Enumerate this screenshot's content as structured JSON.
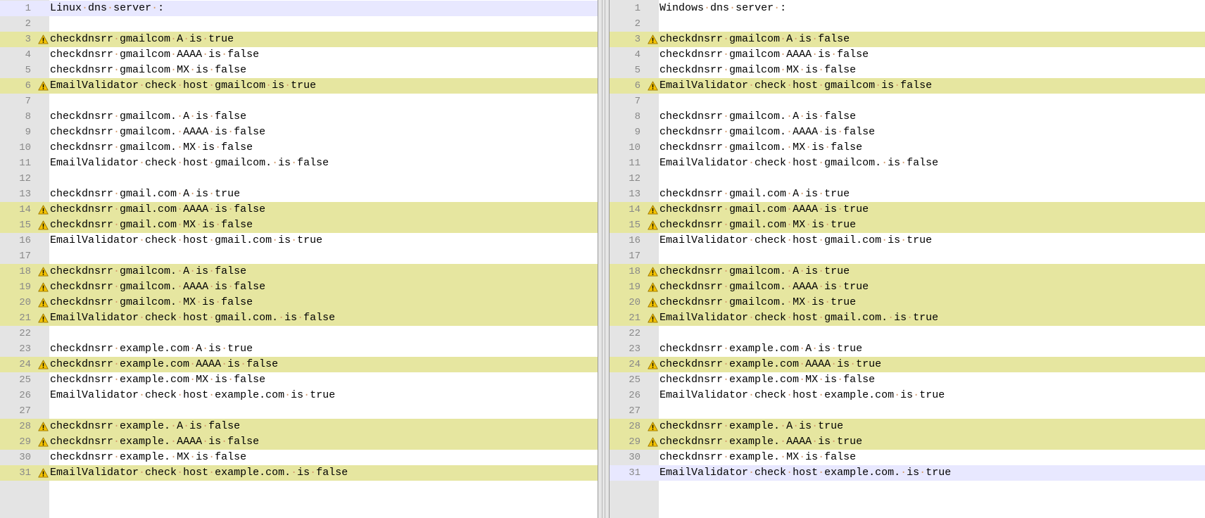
{
  "colors": {
    "diff_line": "#e6e6a0",
    "current_line": "#e8e8ff",
    "gutter": "#e4e4e4",
    "line_number": "#888888",
    "whitespace_dot": "#d49a6a"
  },
  "icons": {
    "diff_marker": "warning-triangle-icon"
  },
  "left_pane": {
    "lines": [
      {
        "num": "1",
        "text": "Linux dns server :",
        "state": "current"
      },
      {
        "num": "2",
        "text": "",
        "state": "same"
      },
      {
        "num": "3",
        "text": "checkdnsrr gmailcom A is true",
        "state": "diff"
      },
      {
        "num": "4",
        "text": "checkdnsrr gmailcom AAAA is false",
        "state": "same"
      },
      {
        "num": "5",
        "text": "checkdnsrr gmailcom MX is false",
        "state": "same"
      },
      {
        "num": "6",
        "text": "EmailValidator check host gmailcom is true",
        "state": "diff"
      },
      {
        "num": "7",
        "text": "",
        "state": "same"
      },
      {
        "num": "8",
        "text": "checkdnsrr gmailcom. A is false",
        "state": "same"
      },
      {
        "num": "9",
        "text": "checkdnsrr gmailcom. AAAA is false",
        "state": "same"
      },
      {
        "num": "10",
        "text": "checkdnsrr gmailcom. MX is false",
        "state": "same"
      },
      {
        "num": "11",
        "text": "EmailValidator check host gmailcom. is false",
        "state": "same"
      },
      {
        "num": "12",
        "text": "",
        "state": "same"
      },
      {
        "num": "13",
        "text": "checkdnsrr gmail.com A is true",
        "state": "same"
      },
      {
        "num": "14",
        "text": "checkdnsrr gmail.com AAAA is false",
        "state": "diff"
      },
      {
        "num": "15",
        "text": "checkdnsrr gmail.com MX is false",
        "state": "diff"
      },
      {
        "num": "16",
        "text": "EmailValidator check host gmail.com is true",
        "state": "same"
      },
      {
        "num": "17",
        "text": "",
        "state": "same"
      },
      {
        "num": "18",
        "text": "checkdnsrr gmailcom. A is false",
        "state": "diff"
      },
      {
        "num": "19",
        "text": "checkdnsrr gmailcom. AAAA is false",
        "state": "diff"
      },
      {
        "num": "20",
        "text": "checkdnsrr gmailcom. MX is false",
        "state": "diff"
      },
      {
        "num": "21",
        "text": "EmailValidator check host gmail.com. is false",
        "state": "diff"
      },
      {
        "num": "22",
        "text": "",
        "state": "same"
      },
      {
        "num": "23",
        "text": "checkdnsrr example.com A is true",
        "state": "same"
      },
      {
        "num": "24",
        "text": "checkdnsrr example.com AAAA is false",
        "state": "diff"
      },
      {
        "num": "25",
        "text": "checkdnsrr example.com MX is false",
        "state": "same"
      },
      {
        "num": "26",
        "text": "EmailValidator check host example.com is true",
        "state": "same"
      },
      {
        "num": "27",
        "text": "",
        "state": "same"
      },
      {
        "num": "28",
        "text": "checkdnsrr example. A is false",
        "state": "diff"
      },
      {
        "num": "29",
        "text": "checkdnsrr example. AAAA is false",
        "state": "diff"
      },
      {
        "num": "30",
        "text": "checkdnsrr example. MX is false",
        "state": "same"
      },
      {
        "num": "31",
        "text": "EmailValidator check host example.com. is false",
        "state": "diff"
      }
    ]
  },
  "right_pane": {
    "lines": [
      {
        "num": "1",
        "text": "Windows dns server :",
        "state": "same"
      },
      {
        "num": "2",
        "text": "",
        "state": "same"
      },
      {
        "num": "3",
        "text": "checkdnsrr gmailcom A is false",
        "state": "diff"
      },
      {
        "num": "4",
        "text": "checkdnsrr gmailcom AAAA is false",
        "state": "same"
      },
      {
        "num": "5",
        "text": "checkdnsrr gmailcom MX is false",
        "state": "same"
      },
      {
        "num": "6",
        "text": "EmailValidator check host gmailcom is false",
        "state": "diff"
      },
      {
        "num": "7",
        "text": "",
        "state": "same"
      },
      {
        "num": "8",
        "text": "checkdnsrr gmailcom. A is false",
        "state": "same"
      },
      {
        "num": "9",
        "text": "checkdnsrr gmailcom. AAAA is false",
        "state": "same"
      },
      {
        "num": "10",
        "text": "checkdnsrr gmailcom. MX is false",
        "state": "same"
      },
      {
        "num": "11",
        "text": "EmailValidator check host gmailcom. is false",
        "state": "same"
      },
      {
        "num": "12",
        "text": "",
        "state": "same"
      },
      {
        "num": "13",
        "text": "checkdnsrr gmail.com A is true",
        "state": "same"
      },
      {
        "num": "14",
        "text": "checkdnsrr gmail.com AAAA is true",
        "state": "diff"
      },
      {
        "num": "15",
        "text": "checkdnsrr gmail.com MX is true",
        "state": "diff"
      },
      {
        "num": "16",
        "text": "EmailValidator check host gmail.com is true",
        "state": "same"
      },
      {
        "num": "17",
        "text": "",
        "state": "same"
      },
      {
        "num": "18",
        "text": "checkdnsrr gmailcom. A is true",
        "state": "diff"
      },
      {
        "num": "19",
        "text": "checkdnsrr gmailcom. AAAA is true",
        "state": "diff"
      },
      {
        "num": "20",
        "text": "checkdnsrr gmailcom. MX is true",
        "state": "diff"
      },
      {
        "num": "21",
        "text": "EmailValidator check host gmail.com. is true",
        "state": "diff"
      },
      {
        "num": "22",
        "text": "",
        "state": "same"
      },
      {
        "num": "23",
        "text": "checkdnsrr example.com A is true",
        "state": "same"
      },
      {
        "num": "24",
        "text": "checkdnsrr example.com AAAA is true",
        "state": "diff"
      },
      {
        "num": "25",
        "text": "checkdnsrr example.com MX is false",
        "state": "same"
      },
      {
        "num": "26",
        "text": "EmailValidator check host example.com is true",
        "state": "same"
      },
      {
        "num": "27",
        "text": "",
        "state": "same"
      },
      {
        "num": "28",
        "text": "checkdnsrr example. A is true",
        "state": "diff"
      },
      {
        "num": "29",
        "text": "checkdnsrr example. AAAA is true",
        "state": "diff"
      },
      {
        "num": "30",
        "text": "checkdnsrr example. MX is false",
        "state": "same"
      },
      {
        "num": "31",
        "text": "EmailValidator check host example.com. is true",
        "state": "current"
      }
    ]
  }
}
